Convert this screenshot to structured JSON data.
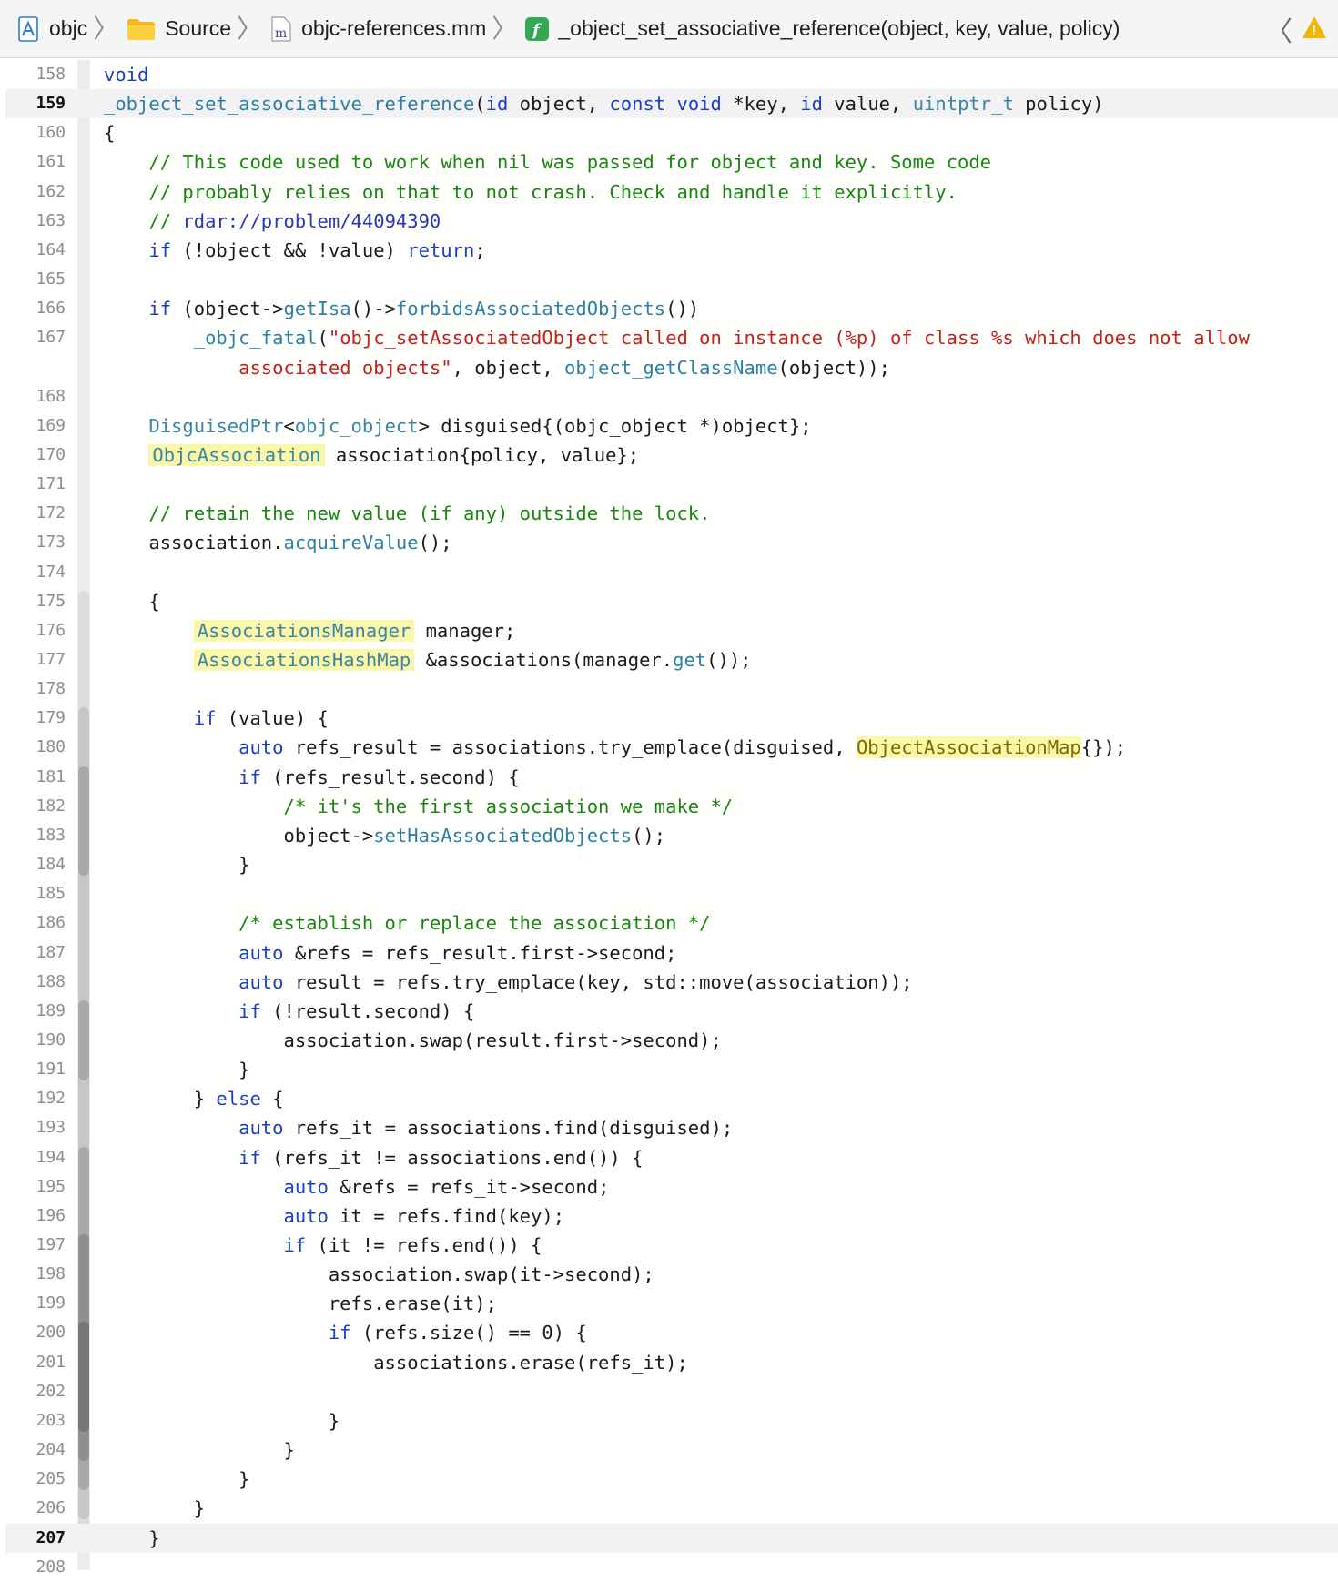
{
  "breadcrumb": {
    "items": [
      {
        "label": "objc",
        "icon": "xcode-project-icon"
      },
      {
        "label": "Source",
        "icon": "folder-icon"
      },
      {
        "label": "objc-references.mm",
        "icon": "objc-file-icon",
        "icon_glyph": "m"
      },
      {
        "label": "_object_set_associative_reference(object, key, value, policy)",
        "icon": "function-icon",
        "icon_glyph": "f"
      }
    ],
    "separator": "〉",
    "back_glyph": "〈",
    "warning_glyph": "!"
  },
  "editor": {
    "current_line": "159",
    "caret_line": "207",
    "lines": [
      {
        "n": "158",
        "segs": [
          {
            "t": "void",
            "c": "kw"
          }
        ]
      },
      {
        "n": "159",
        "segs": [
          {
            "t": "_object_set_associative_reference",
            "c": "fn"
          },
          {
            "t": "(",
            "c": ""
          },
          {
            "t": "id",
            "c": "kw"
          },
          {
            "t": " object, ",
            "c": ""
          },
          {
            "t": "const",
            "c": "kw"
          },
          {
            "t": " ",
            "c": ""
          },
          {
            "t": "void",
            "c": "kw"
          },
          {
            "t": " *key, ",
            "c": ""
          },
          {
            "t": "id",
            "c": "kw"
          },
          {
            "t": " value, ",
            "c": ""
          },
          {
            "t": "uintptr_t",
            "c": "ty"
          },
          {
            "t": " policy)",
            "c": ""
          }
        ]
      },
      {
        "n": "160",
        "segs": [
          {
            "t": "{",
            "c": ""
          }
        ]
      },
      {
        "n": "161",
        "segs": [
          {
            "t": "    // This code used to work when nil was passed for object and key. Some code",
            "c": "cm"
          }
        ]
      },
      {
        "n": "162",
        "segs": [
          {
            "t": "    // probably relies on that to not crash. Check and handle it explicitly.",
            "c": "cm"
          }
        ]
      },
      {
        "n": "163",
        "segs": [
          {
            "t": "    // ",
            "c": "cm"
          },
          {
            "t": "rdar://problem/44094390",
            "c": "lk"
          }
        ]
      },
      {
        "n": "164",
        "segs": [
          {
            "t": "    ",
            "c": ""
          },
          {
            "t": "if",
            "c": "kw"
          },
          {
            "t": " (!object && !value) ",
            "c": ""
          },
          {
            "t": "return",
            "c": "kw"
          },
          {
            "t": ";",
            "c": ""
          }
        ]
      },
      {
        "n": "165",
        "segs": []
      },
      {
        "n": "166",
        "segs": [
          {
            "t": "    ",
            "c": ""
          },
          {
            "t": "if",
            "c": "kw"
          },
          {
            "t": " (object->",
            "c": ""
          },
          {
            "t": "getIsa",
            "c": "fn"
          },
          {
            "t": "()->",
            "c": ""
          },
          {
            "t": "forbidsAssociatedObjects",
            "c": "fn"
          },
          {
            "t": "())",
            "c": ""
          }
        ]
      },
      {
        "n": "167",
        "segs": [
          {
            "t": "        ",
            "c": ""
          },
          {
            "t": "_objc_fatal",
            "c": "fn"
          },
          {
            "t": "(",
            "c": ""
          },
          {
            "t": "\"objc_setAssociatedObject called on instance (%p) of class %s which does not allow",
            "c": "st"
          }
        ]
      },
      {
        "n": "",
        "segs": [
          {
            "t": "            ",
            "c": ""
          },
          {
            "t": "associated objects\"",
            "c": "st"
          },
          {
            "t": ", object, ",
            "c": ""
          },
          {
            "t": "object_getClassName",
            "c": "fn"
          },
          {
            "t": "(object));",
            "c": ""
          }
        ]
      },
      {
        "n": "168",
        "segs": []
      },
      {
        "n": "169",
        "segs": [
          {
            "t": "    ",
            "c": ""
          },
          {
            "t": "DisguisedPtr",
            "c": "ty"
          },
          {
            "t": "<",
            "c": ""
          },
          {
            "t": "objc_object",
            "c": "ty"
          },
          {
            "t": "> disguised{(objc_object *)object};",
            "c": ""
          }
        ]
      },
      {
        "n": "170",
        "segs": [
          {
            "t": "    ",
            "c": ""
          },
          {
            "t": "ObjcAssociation",
            "c": "hl"
          },
          {
            "t": " association{policy, value};",
            "c": ""
          }
        ]
      },
      {
        "n": "171",
        "segs": []
      },
      {
        "n": "172",
        "segs": [
          {
            "t": "    // retain the new value (if any) outside the lock.",
            "c": "cm"
          }
        ]
      },
      {
        "n": "173",
        "segs": [
          {
            "t": "    association.",
            "c": ""
          },
          {
            "t": "acquireValue",
            "c": "fn"
          },
          {
            "t": "();",
            "c": ""
          }
        ]
      },
      {
        "n": "174",
        "segs": []
      },
      {
        "n": "175",
        "segs": [
          {
            "t": "    {",
            "c": ""
          }
        ]
      },
      {
        "n": "176",
        "segs": [
          {
            "t": "        ",
            "c": ""
          },
          {
            "t": "AssociationsManager",
            "c": "hl"
          },
          {
            "t": " manager;",
            "c": ""
          }
        ]
      },
      {
        "n": "177",
        "segs": [
          {
            "t": "        ",
            "c": ""
          },
          {
            "t": "AssociationsHashMap",
            "c": "hl"
          },
          {
            "t": " &associations(manager.",
            "c": ""
          },
          {
            "t": "get",
            "c": "fn"
          },
          {
            "t": "());",
            "c": ""
          }
        ]
      },
      {
        "n": "178",
        "segs": []
      },
      {
        "n": "179",
        "segs": [
          {
            "t": "        ",
            "c": ""
          },
          {
            "t": "if",
            "c": "kw"
          },
          {
            "t": " (value) {",
            "c": ""
          }
        ]
      },
      {
        "n": "180",
        "segs": [
          {
            "t": "            ",
            "c": ""
          },
          {
            "t": "auto",
            "c": "kw"
          },
          {
            "t": " refs_result = associations.try_emplace(disguised, ",
            "c": ""
          },
          {
            "t": "ObjectAssociationMap",
            "c": "hl2"
          },
          {
            "t": "{});",
            "c": ""
          }
        ]
      },
      {
        "n": "181",
        "segs": [
          {
            "t": "            ",
            "c": ""
          },
          {
            "t": "if",
            "c": "kw"
          },
          {
            "t": " (refs_result.second) {",
            "c": ""
          }
        ]
      },
      {
        "n": "182",
        "segs": [
          {
            "t": "                /* it's the first association we make */",
            "c": "cm"
          }
        ]
      },
      {
        "n": "183",
        "segs": [
          {
            "t": "                object->",
            "c": ""
          },
          {
            "t": "setHasAssociatedObjects",
            "c": "fn"
          },
          {
            "t": "();",
            "c": ""
          }
        ]
      },
      {
        "n": "184",
        "segs": [
          {
            "t": "            }",
            "c": ""
          }
        ]
      },
      {
        "n": "185",
        "segs": []
      },
      {
        "n": "186",
        "segs": [
          {
            "t": "            /* establish or replace the association */",
            "c": "cm"
          }
        ]
      },
      {
        "n": "187",
        "segs": [
          {
            "t": "            ",
            "c": ""
          },
          {
            "t": "auto",
            "c": "kw"
          },
          {
            "t": " &refs = refs_result.first->second;",
            "c": ""
          }
        ]
      },
      {
        "n": "188",
        "segs": [
          {
            "t": "            ",
            "c": ""
          },
          {
            "t": "auto",
            "c": "kw"
          },
          {
            "t": " result = refs.try_emplace(key, std::move(association));",
            "c": ""
          }
        ]
      },
      {
        "n": "189",
        "segs": [
          {
            "t": "            ",
            "c": ""
          },
          {
            "t": "if",
            "c": "kw"
          },
          {
            "t": " (!result.second) {",
            "c": ""
          }
        ]
      },
      {
        "n": "190",
        "segs": [
          {
            "t": "                association.swap(result.first->second);",
            "c": ""
          }
        ]
      },
      {
        "n": "191",
        "segs": [
          {
            "t": "            }",
            "c": ""
          }
        ]
      },
      {
        "n": "192",
        "segs": [
          {
            "t": "        } ",
            "c": ""
          },
          {
            "t": "else",
            "c": "kw"
          },
          {
            "t": " {",
            "c": ""
          }
        ]
      },
      {
        "n": "193",
        "segs": [
          {
            "t": "            ",
            "c": ""
          },
          {
            "t": "auto",
            "c": "kw"
          },
          {
            "t": " refs_it = associations.find(disguised);",
            "c": ""
          }
        ]
      },
      {
        "n": "194",
        "segs": [
          {
            "t": "            ",
            "c": ""
          },
          {
            "t": "if",
            "c": "kw"
          },
          {
            "t": " (refs_it != associations.end()) {",
            "c": ""
          }
        ]
      },
      {
        "n": "195",
        "segs": [
          {
            "t": "                ",
            "c": ""
          },
          {
            "t": "auto",
            "c": "kw"
          },
          {
            "t": " &refs = refs_it->second;",
            "c": ""
          }
        ]
      },
      {
        "n": "196",
        "segs": [
          {
            "t": "                ",
            "c": ""
          },
          {
            "t": "auto",
            "c": "kw"
          },
          {
            "t": " it = refs.find(key);",
            "c": ""
          }
        ]
      },
      {
        "n": "197",
        "segs": [
          {
            "t": "                ",
            "c": ""
          },
          {
            "t": "if",
            "c": "kw"
          },
          {
            "t": " (it != refs.end()) {",
            "c": ""
          }
        ]
      },
      {
        "n": "198",
        "segs": [
          {
            "t": "                    association.swap(it->second);",
            "c": ""
          }
        ]
      },
      {
        "n": "199",
        "segs": [
          {
            "t": "                    refs.erase(it);",
            "c": ""
          }
        ]
      },
      {
        "n": "200",
        "segs": [
          {
            "t": "                    ",
            "c": ""
          },
          {
            "t": "if",
            "c": "kw"
          },
          {
            "t": " (refs.size() == 0) {",
            "c": ""
          }
        ]
      },
      {
        "n": "201",
        "segs": [
          {
            "t": "                        associations.erase(refs_it);",
            "c": ""
          }
        ]
      },
      {
        "n": "202",
        "segs": []
      },
      {
        "n": "203",
        "segs": [
          {
            "t": "                    }",
            "c": ""
          }
        ]
      },
      {
        "n": "204",
        "segs": [
          {
            "t": "                }",
            "c": ""
          }
        ]
      },
      {
        "n": "205",
        "segs": [
          {
            "t": "            }",
            "c": ""
          }
        ]
      },
      {
        "n": "206",
        "segs": [
          {
            "t": "        }",
            "c": ""
          }
        ]
      },
      {
        "n": "207",
        "segs": [
          {
            "t": "    }",
            "c": ""
          }
        ]
      },
      {
        "n": "208",
        "segs": []
      }
    ]
  },
  "colors": {
    "keyword": "#1a3ec9",
    "function": "#2c7fa5",
    "type": "#3a86a8",
    "comment": "#18850e",
    "string": "#c2211a",
    "highlight": "#fbf7a8",
    "warning": "#f5b400"
  }
}
